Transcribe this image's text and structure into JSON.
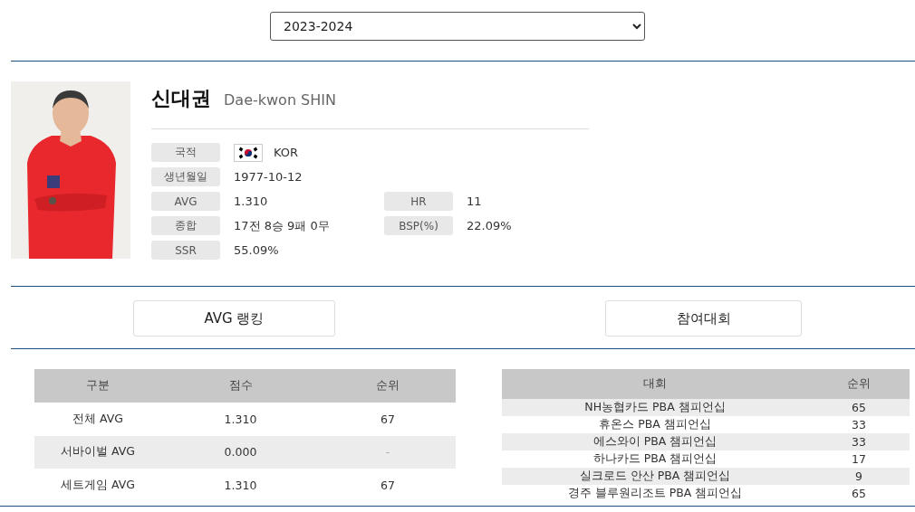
{
  "season_select": {
    "value": "2023-2024"
  },
  "player": {
    "name_ko": "신대권",
    "name_en": "Dae-kwon SHIN",
    "info": [
      {
        "label": "국적",
        "value": "KOR",
        "has_flag": true
      },
      {
        "label": "생년월일",
        "value": "1977-10-12"
      },
      {
        "label": "AVG",
        "value": "1.310",
        "label2": "HR",
        "value2": "11"
      },
      {
        "label": "종합",
        "value": "17전 8승 9패 0무",
        "label2": "BSP(%)",
        "value2": "22.09%"
      },
      {
        "label": "SSR",
        "value": "55.09%"
      }
    ]
  },
  "tabs": [
    {
      "label": "AVG 랭킹"
    },
    {
      "label": "참여대회"
    }
  ],
  "avg_table": {
    "columns": [
      "구분",
      "점수",
      "순위"
    ],
    "rows": [
      [
        "전체 AVG",
        "1.310",
        "67"
      ],
      [
        "서바이벌 AVG",
        "0.000",
        "-"
      ],
      [
        "세트게임 AVG",
        "1.310",
        "67"
      ]
    ]
  },
  "tournament_table": {
    "columns": [
      "대회",
      "순위"
    ],
    "rows": [
      [
        "NH농협카드 PBA 챔피언십",
        "65"
      ],
      [
        "휴온스 PBA 챔피언십",
        "33"
      ],
      [
        "에스와이 PBA 챔피언십",
        "33"
      ],
      [
        "하나카드 PBA 챔피언십",
        "17"
      ],
      [
        "실크로드 안산 PBA 챔피언십",
        "9"
      ],
      [
        "경주 블루원리조트 PBA 챔피언십",
        "65"
      ]
    ]
  }
}
